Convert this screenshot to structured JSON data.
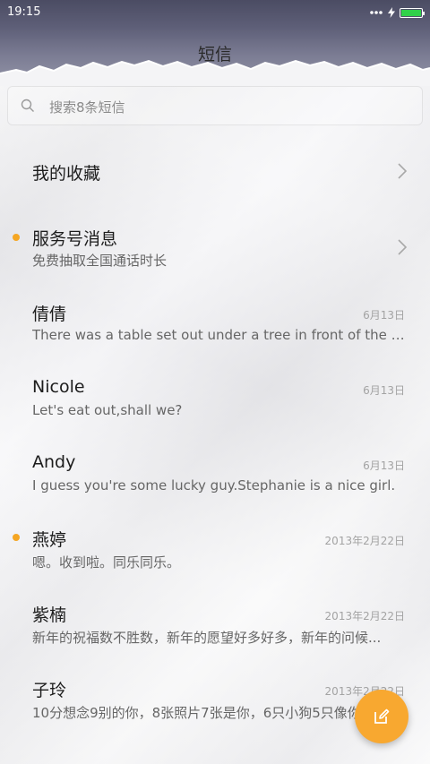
{
  "status_bar": {
    "time": "19:15"
  },
  "header": {
    "title": "短信"
  },
  "search": {
    "placeholder": "搜索8条短信"
  },
  "conversations": [
    {
      "name": "我的收藏",
      "preview": "",
      "date": "",
      "unread": false,
      "chevron": true
    },
    {
      "name": "服务号消息",
      "preview": "免费抽取全国通话时长",
      "date": "",
      "unread": true,
      "chevron": true
    },
    {
      "name": "倩倩",
      "preview": "There was a table set out under a tree in front of the ho...",
      "date": "6月13日",
      "unread": false,
      "chevron": false
    },
    {
      "name": "Nicole",
      "preview": "Let's eat out,shall we?",
      "date": "6月13日",
      "unread": false,
      "chevron": false
    },
    {
      "name": "Andy",
      "preview": "I guess you're some lucky guy.Stephanie is a nice girl.",
      "date": "6月13日",
      "unread": false,
      "chevron": false
    },
    {
      "name": "燕婷",
      "preview": "嗯。收到啦。同乐同乐。",
      "date": "2013年2月22日",
      "unread": true,
      "chevron": false
    },
    {
      "name": "紫楠",
      "preview": "新年的祝福数不胜数，新年的愿望好多好多，新年的问候...",
      "date": "2013年2月22日",
      "unread": false,
      "chevron": false
    },
    {
      "name": "子玲",
      "preview": "10分想念9别的你，8张照片7张是你，6只小狗5只像你",
      "date": "2013年2月22日",
      "unread": false,
      "chevron": false
    }
  ],
  "icons": {
    "search": "search-icon",
    "compose": "compose-icon",
    "chevron": "chevron-right-icon",
    "battery": "battery-icon",
    "charging": "charging-bolt-icon",
    "wifi": "signal-dots-icon"
  },
  "colors": {
    "accent": "#f8a830",
    "unread_dot": "#f5a623",
    "battery": "#31d14a"
  }
}
